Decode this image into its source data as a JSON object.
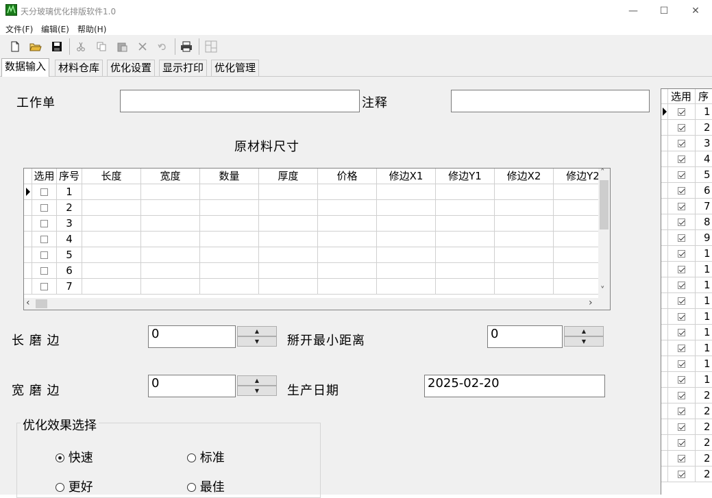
{
  "window": {
    "title": "天分玻璃优化排版软件1.0",
    "minimize_glyph": "—",
    "maximize_glyph": "☐",
    "close_glyph": "✕"
  },
  "menu": [
    "文件(F)",
    "编辑(E)",
    "帮助(H)"
  ],
  "toolbar": {
    "icons": [
      "new-file-icon",
      "open-folder-icon",
      "save-icon",
      "cut-icon",
      "copy-icon",
      "paste-icon",
      "delete-icon",
      "undo-icon",
      "print-icon",
      "layout-grid-icon"
    ]
  },
  "tabs": [
    "数据输入",
    "材料仓库",
    "优化设置",
    "显示打印",
    "优化管理"
  ],
  "form": {
    "work_order_label": "工作单",
    "work_order_value": "",
    "note_label": "注释",
    "note_value": "",
    "raw_size_title": "原材料尺寸",
    "long_edge_label": "长 磨 边",
    "long_edge_value": "0",
    "min_gap_label": "掰开最小距离",
    "min_gap_value": "0",
    "wide_edge_label": "宽 磨 边",
    "wide_edge_value": "0",
    "prod_date_label": "生产日期",
    "prod_date_value": "2025-02-20"
  },
  "grid": {
    "columns": [
      "选用",
      "序号",
      "长度",
      "宽度",
      "数量",
      "厚度",
      "价格",
      "修边X1",
      "修边Y1",
      "修边X2",
      "修边Y2"
    ],
    "rows": [
      "1",
      "2",
      "3",
      "4",
      "5",
      "6",
      "7"
    ]
  },
  "optimization": {
    "title": "优化效果选择",
    "options": [
      {
        "label": "快速",
        "selected": true
      },
      {
        "label": "标准",
        "selected": false
      },
      {
        "label": "更好",
        "selected": false
      },
      {
        "label": "最佳",
        "selected": false
      }
    ]
  },
  "right_grid": {
    "columns": [
      "选用",
      "序"
    ],
    "rows": [
      "1",
      "2",
      "3",
      "4",
      "5",
      "6",
      "7",
      "8",
      "9",
      "1",
      "1",
      "1",
      "1",
      "1",
      "1",
      "1",
      "1",
      "1",
      "2",
      "2",
      "2",
      "2",
      "2",
      "2"
    ]
  }
}
